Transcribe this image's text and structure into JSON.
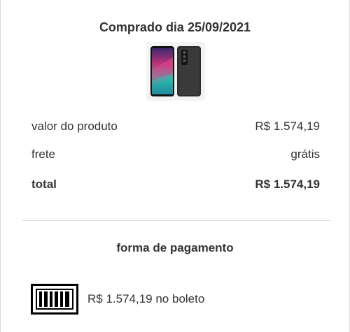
{
  "purchase": {
    "date_label": "Comprado dia 25/09/2021"
  },
  "summary": {
    "product_label": "valor do produto",
    "product_value": "R$ 1.574,19",
    "shipping_label": "frete",
    "shipping_value": "grátis",
    "total_label": "total",
    "total_value": "R$ 1.574,19"
  },
  "payment": {
    "title": "forma de pagamento",
    "method_text": "R$ 1.574,19 no boleto",
    "icon": "barcode-boleto-icon"
  },
  "colors": {
    "text": "#333333",
    "divider": "#dedede",
    "thumb_bg": "#f3f3f3"
  }
}
